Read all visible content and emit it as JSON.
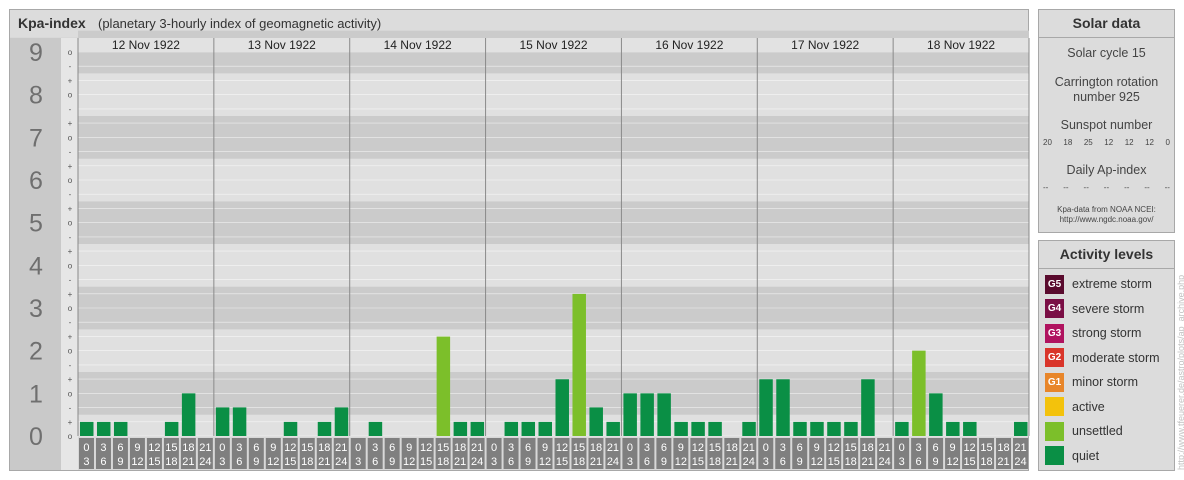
{
  "title": {
    "main": "Kpa-index",
    "sub": "(planetary 3-hourly index of geomagnetic activity)"
  },
  "chart_data": {
    "type": "bar",
    "ylim": [
      0,
      9
    ],
    "y_major_labels": [
      "0",
      "1",
      "2",
      "3",
      "4",
      "5",
      "6",
      "7",
      "8",
      "9"
    ],
    "y_minor_labels": [
      "-",
      "o",
      "+"
    ],
    "days": [
      "12 Nov 1922",
      "13 Nov 1922",
      "14 Nov 1922",
      "15 Nov 1922",
      "16 Nov 1922",
      "17 Nov 1922",
      "18 Nov 1922"
    ],
    "intervals": [
      {
        "top": "0",
        "bottom": "3"
      },
      {
        "top": "3",
        "bottom": "6"
      },
      {
        "top": "6",
        "bottom": "9"
      },
      {
        "top": "9",
        "bottom": "12"
      },
      {
        "top": "12",
        "bottom": "15"
      },
      {
        "top": "15",
        "bottom": "18"
      },
      {
        "top": "18",
        "bottom": "21"
      },
      {
        "top": "21",
        "bottom": "24"
      }
    ],
    "series": [
      {
        "values": [
          0.33,
          0.33,
          0.33,
          0,
          0,
          0.33,
          1,
          0,
          0.67,
          0.67,
          0,
          0,
          0.33,
          0,
          0.33,
          0.67,
          0,
          0.33,
          0,
          0,
          0,
          2.33,
          0.33,
          0.33,
          0,
          0.33,
          0.33,
          0.33,
          1.33,
          3.33,
          0.67,
          0.33,
          1,
          1,
          1,
          0.33,
          0.33,
          0.33,
          0,
          0.33,
          1.33,
          1.33,
          0.33,
          0.33,
          0.33,
          0.33,
          1.33,
          0,
          0.33,
          2,
          1,
          0.33,
          0.33,
          0,
          0,
          0.33
        ]
      }
    ]
  },
  "colors": {
    "quiet": "#0a8f45",
    "unsettled": "#7cbf2a"
  },
  "solar": {
    "title": "Solar data",
    "cycle": "Solar cycle 15",
    "carrington_line1": "Carrington rotation",
    "carrington_line2": "number 925",
    "sunspot_label": "Sunspot number",
    "sunspot_values": [
      "20",
      "18",
      "25",
      "12",
      "12",
      "12",
      "0"
    ],
    "ap_label": "Daily Ap-index",
    "ap_values": [
      "--",
      "--",
      "--",
      "--",
      "--",
      "--",
      "--"
    ],
    "source_line1": "Kpa-data from NOAA NCEI:",
    "source_line2": "http://www.ngdc.noaa.gov/"
  },
  "activity": {
    "title": "Activity levels",
    "levels": [
      {
        "badge": "G5",
        "label": "extreme storm",
        "color": "#5a0b2e"
      },
      {
        "badge": "G4",
        "label": "severe storm",
        "color": "#7a0e45"
      },
      {
        "badge": "G3",
        "label": "strong storm",
        "color": "#b0135f"
      },
      {
        "badge": "G2",
        "label": "moderate storm",
        "color": "#d9352a"
      },
      {
        "badge": "G1",
        "label": "minor storm",
        "color": "#e8862a"
      },
      {
        "badge": "",
        "label": "active",
        "color": "#f3c20c"
      },
      {
        "badge": "",
        "label": "unsettled",
        "color": "#7cbf2a"
      },
      {
        "badge": "",
        "label": "quiet",
        "color": "#0a8f45"
      }
    ]
  },
  "credit": "http://www.tfeuerer.de/astro/plots/ap_archive.php"
}
